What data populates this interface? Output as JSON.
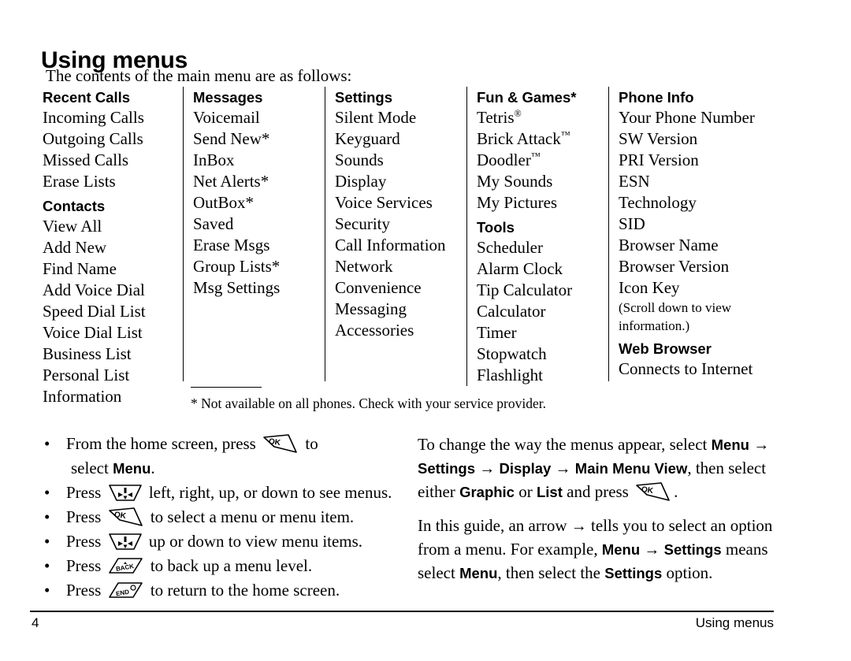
{
  "page": {
    "title": "Using menus",
    "intro": "The contents of the main menu are as follows:",
    "footnote": "* Not available on all phones. Check with your service provider."
  },
  "menu_columns": [
    {
      "groups": [
        {
          "heading": "Recent Calls",
          "items": [
            "Incoming Calls",
            "Outgoing Calls",
            "Missed Calls",
            "Erase Lists"
          ]
        },
        {
          "heading": "Contacts",
          "items": [
            "View All",
            "Add New",
            "Find Name",
            "Add Voice Dial",
            "Speed Dial List",
            "Voice Dial List",
            "Business List",
            "Personal List",
            "Information"
          ]
        }
      ]
    },
    {
      "groups": [
        {
          "heading": "Messages",
          "items": [
            "Voicemail",
            "Send New*",
            "InBox",
            "Net Alerts*",
            "OutBox*",
            "Saved",
            "Erase Msgs",
            "Group Lists*",
            "Msg Settings"
          ]
        }
      ]
    },
    {
      "groups": [
        {
          "heading": "Settings",
          "items": [
            "Silent Mode",
            "Keyguard",
            "Sounds",
            "Display",
            "Voice Services",
            "Security",
            "Call Information",
            "Network",
            "Convenience",
            "Messaging",
            "Accessories"
          ]
        }
      ]
    },
    {
      "groups": [
        {
          "heading": "Fun & Games*",
          "items": [
            "Tetris®",
            "Brick Attack™",
            "Doodler™",
            "My Sounds",
            "My Pictures"
          ]
        },
        {
          "heading": "Tools",
          "items": [
            "Scheduler",
            "Alarm Clock",
            "Tip Calculator",
            "Calculator",
            "Timer",
            "Stopwatch",
            "Flashlight"
          ]
        }
      ]
    },
    {
      "groups": [
        {
          "heading": "Phone Info",
          "items": [
            "Your Phone Number",
            "SW Version",
            "PRI Version",
            "ESN",
            "Technology",
            "SID",
            "Browser Name",
            "Browser Version",
            "Icon Key",
            "(Scroll down to view",
            "information.)"
          ]
        },
        {
          "heading": "Web Browser",
          "items": [
            "Connects to Internet"
          ]
        }
      ]
    }
  ],
  "steps": [
    {
      "before": "From the home screen, press",
      "icon": "ok-key-icon",
      "after": "to",
      "line2_before": "select",
      "line2_bold": "Menu",
      "line2_after": "."
    },
    {
      "before": "Press",
      "icon": "navigation-key-icon",
      "after": "left, right, up, or down to see menus."
    },
    {
      "before": "Press",
      "icon": "ok-key-icon",
      "after": "to select a menu or menu item."
    },
    {
      "before": "Press",
      "icon": "navigation-key-icon",
      "after": "up or down to view menu items."
    },
    {
      "before": "Press",
      "icon": "back-key-icon",
      "after": "to back up a menu level."
    },
    {
      "before": "Press",
      "icon": "end-key-icon",
      "after": "to return to the home screen."
    }
  ],
  "notes": {
    "para1": {
      "p1": "To change the way the menus appear, select",
      "b1": "Menu",
      "a1": "→",
      "b2": "Settings",
      "a2": "→",
      "b3": "Display",
      "a3": "→",
      "b4": "Main Menu View",
      "p2": ", then select either",
      "b5": "Graphic",
      "p3": "or",
      "b6": "List",
      "p4": "and press",
      "icon": "ok-key-icon",
      "p5": "."
    },
    "para2": {
      "p1": "In this guide, an arrow",
      "a1": "→",
      "p2": "tells you to select an option from a menu. For example,",
      "b1": "Menu",
      "a2": "→",
      "b2": "Settings",
      "p3": "means select",
      "b3": "Menu",
      "p4": ", then select the",
      "b4": "Settings",
      "p5": "option."
    }
  },
  "footer": {
    "page_number": "4",
    "title": "Using menus"
  },
  "key_labels": {
    "ok": "OK",
    "back": "BACK",
    "end": "END"
  }
}
